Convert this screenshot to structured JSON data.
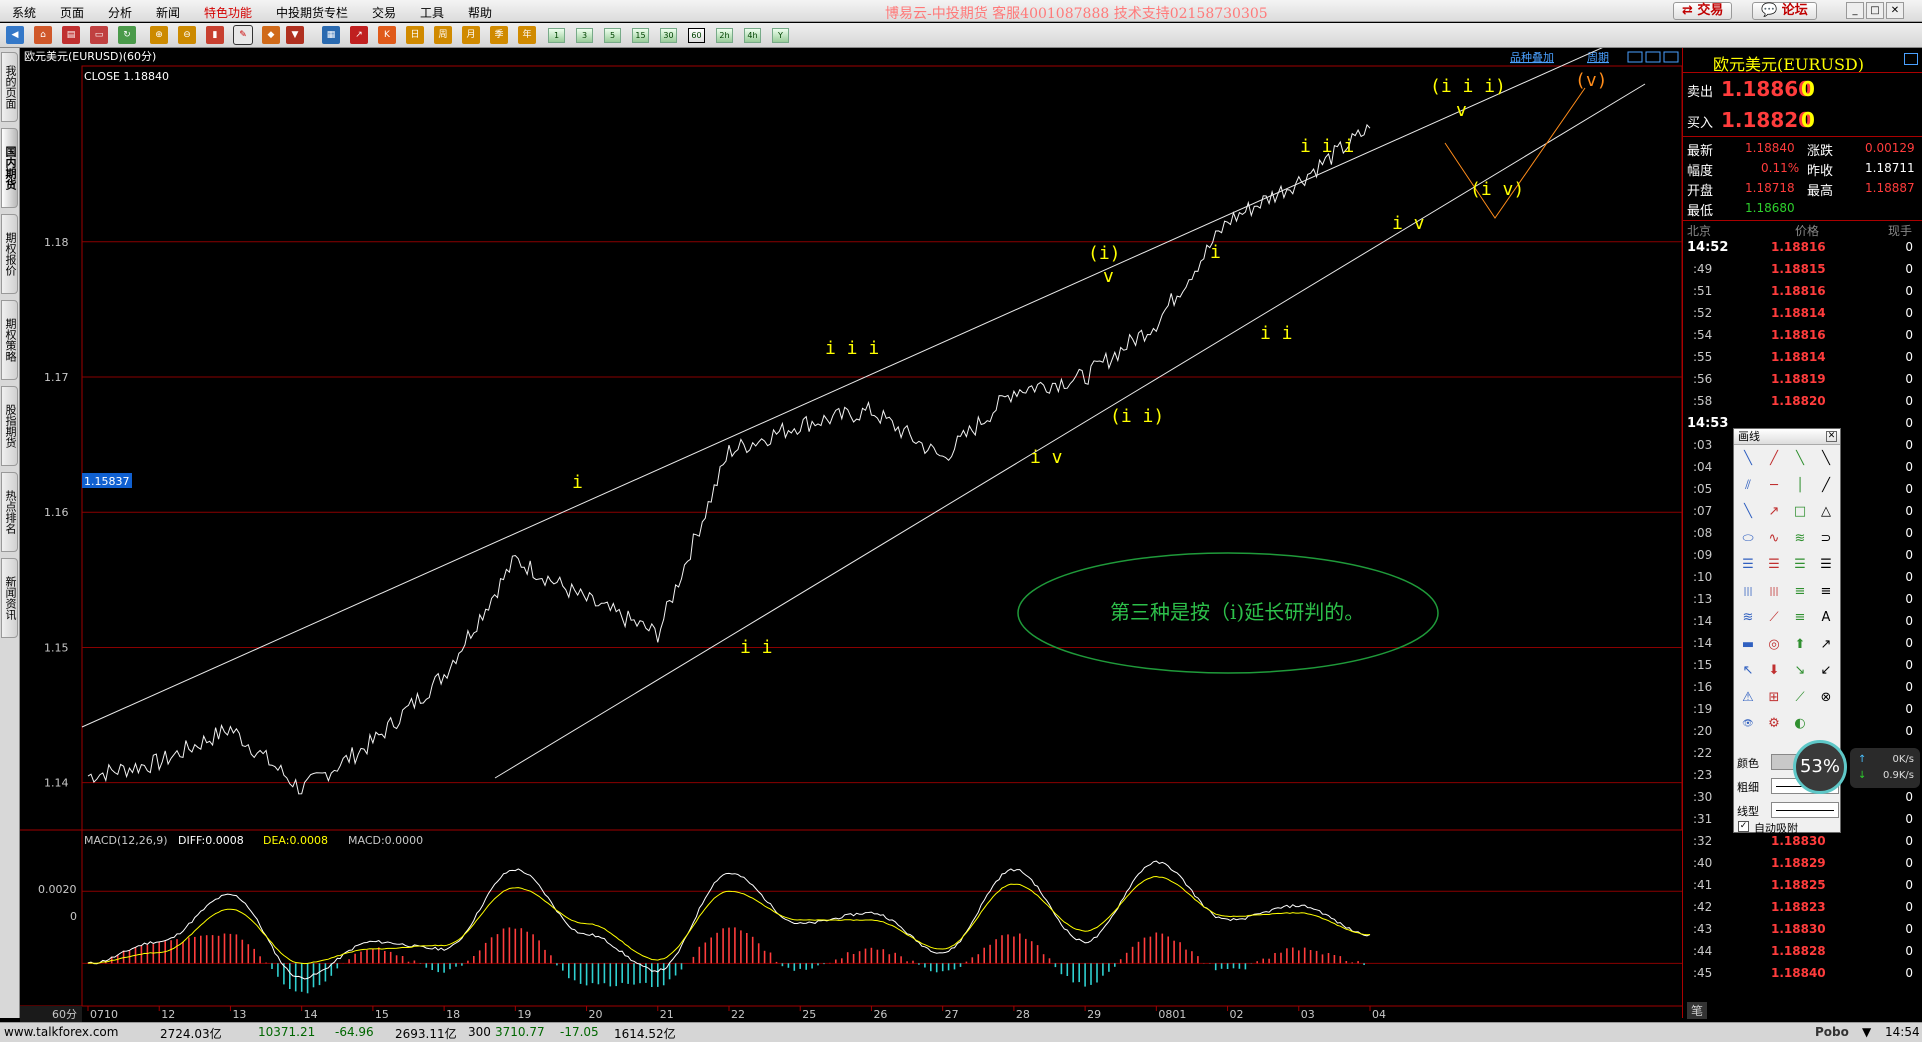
{
  "menu": {
    "items": [
      "系统",
      "页面",
      "分析",
      "新闻",
      "特色功能",
      "中投期货专栏",
      "交易",
      "工具",
      "帮助"
    ],
    "brand_text": "博易云-中投期货 客服4001087888 技术支持02158730305",
    "trade_button": "交易",
    "forum_button": "论坛"
  },
  "toolbar": {
    "period_buttons": [
      "1",
      "3",
      "5",
      "15",
      "30",
      "60",
      "2h",
      "4h",
      "Y"
    ]
  },
  "left_tabs": [
    "我的页面",
    "国内期货",
    "期权报价",
    "期权策略",
    "股指期货",
    "热点排名",
    "新闻资讯"
  ],
  "chart": {
    "title": "欧元美元(EURUSD)(60分)",
    "close_label": "CLOSE 1.18840",
    "overlay_btn": "品种叠加",
    "period_link": "周期",
    "cursor_price": "1.15837",
    "price_ticks": [
      "1.18",
      "1.17",
      "1.16",
      "1.15",
      "1.14"
    ],
    "macd_label": "MACD(12,26,9)",
    "diff_label": "DIFF:0.0008",
    "dea_label": "DEA:0.0008",
    "macd_value": "MACD:0.0000",
    "macd_ticks": [
      "0.0020",
      "0"
    ],
    "period_tag": "60分",
    "date_ticks": [
      "0710",
      "12",
      "13",
      "14",
      "15",
      "18",
      "19",
      "20",
      "21",
      "22",
      "25",
      "26",
      "27",
      "28",
      "29",
      "0801",
      "02",
      "03",
      "04"
    ],
    "wave_labels": [
      {
        "text": "i",
        "color": "yellow"
      },
      {
        "text": "i i",
        "color": "yellow"
      },
      {
        "text": "i i i",
        "color": "yellow"
      },
      {
        "text": "i v",
        "color": "yellow"
      },
      {
        "text": "(i)",
        "color": "yellow"
      },
      {
        "text": "v",
        "color": "yellow"
      },
      {
        "text": "(i i)",
        "color": "yellow"
      },
      {
        "text": "i",
        "color": "yellow"
      },
      {
        "text": "i i",
        "color": "yellow"
      },
      {
        "text": "i i i",
        "color": "yellow"
      },
      {
        "text": "i v",
        "color": "yellow"
      },
      {
        "text": "(i i i)",
        "color": "yellow"
      },
      {
        "text": "v",
        "color": "yellow"
      },
      {
        "text": "(i v)",
        "color": "yellow"
      },
      {
        "text": "(v)",
        "color": "orange"
      }
    ],
    "annotation": "第三种是按（i)延长研判的。",
    "colors": {
      "line": "#ffffff",
      "wave": "#ffff00",
      "orange": "#ff8c1a",
      "macd_up": "#ff3c3c",
      "macd_down": "#2fd0d0",
      "dea": "#ffff00",
      "grid": "#8a0000",
      "ellipse": "#1f9a3a"
    }
  },
  "chart_data": {
    "type": "line",
    "title": "欧元美元(EURUSD)(60分)",
    "ylabel": "",
    "xlabel": "",
    "ylim": [
      1.1365,
      1.193
    ],
    "x": [
      "0710",
      "12",
      "13",
      "14",
      "15",
      "18",
      "19",
      "20",
      "21",
      "22",
      "25",
      "26",
      "27",
      "28",
      "29",
      "0801",
      "02",
      "03",
      "04"
    ],
    "series": [
      {
        "name": "CLOSE",
        "values": [
          1.1405,
          1.1415,
          1.144,
          1.1395,
          1.143,
          1.148,
          1.1565,
          1.1535,
          1.151,
          1.1645,
          1.1665,
          1.1675,
          1.164,
          1.169,
          1.17,
          1.174,
          1.1815,
          1.1845,
          1.1884
        ]
      }
    ],
    "macd": {
      "label": "MACD(12,26,9)",
      "ylim": [
        -0.0011,
        0.0032
      ],
      "diff": [
        0.0,
        0.0006,
        0.0019,
        -0.0004,
        0.0006,
        0.0004,
        0.0026,
        0.0008,
        -0.0002,
        0.0025,
        0.0011,
        0.0014,
        0.0003,
        0.0026,
        0.0006,
        0.0028,
        0.0012,
        0.0016,
        0.0008
      ],
      "dea": [
        0.0,
        0.0003,
        0.0015,
        0.0,
        0.0004,
        0.0005,
        0.0021,
        0.0011,
        0.0001,
        0.002,
        0.0012,
        0.0012,
        0.0004,
        0.0022,
        0.0009,
        0.0024,
        0.0013,
        0.0014,
        0.0008
      ]
    }
  },
  "quote": {
    "title": "欧元美元(EURUSD)",
    "sell_label": "卖出",
    "sell_price": "1.18860",
    "sell_qty": "0",
    "buy_label": "买入",
    "buy_price": "1.18820",
    "buy_qty": "0",
    "stats": [
      {
        "k1": "最新",
        "v1": "1.18840",
        "k2": "涨跌",
        "v2": "0.00129"
      },
      {
        "k1": "幅度",
        "v1": "0.11%",
        "k2": "昨收",
        "v2": "1.18711"
      },
      {
        "k1": "开盘",
        "v1": "1.18718",
        "k2": "最高",
        "v2": "1.18887"
      },
      {
        "k1": "最低",
        "v1": "1.18680",
        "k2": "",
        "v2": ""
      }
    ],
    "ticks_header": {
      "time": "北京",
      "price": "价格",
      "vol": "现手"
    },
    "ticks": [
      {
        "t": "14:52",
        "p": "1.18816",
        "v": "0",
        "full": true
      },
      {
        "t": ":49",
        "p": "1.18815",
        "v": "0"
      },
      {
        "t": ":51",
        "p": "1.18816",
        "v": "0"
      },
      {
        "t": ":52",
        "p": "1.18814",
        "v": "0"
      },
      {
        "t": ":54",
        "p": "1.18816",
        "v": "0"
      },
      {
        "t": ":55",
        "p": "1.18814",
        "v": "0"
      },
      {
        "t": ":56",
        "p": "1.18819",
        "v": "0"
      },
      {
        "t": ":58",
        "p": "1.18820",
        "v": "0"
      },
      {
        "t": "14:53",
        "p": "",
        "v": "0",
        "full": true
      },
      {
        "t": ":03",
        "p": "",
        "v": "0"
      },
      {
        "t": ":04",
        "p": "",
        "v": "0"
      },
      {
        "t": ":05",
        "p": "",
        "v": "0"
      },
      {
        "t": ":07",
        "p": "",
        "v": "0"
      },
      {
        "t": ":08",
        "p": "",
        "v": "0"
      },
      {
        "t": ":09",
        "p": "",
        "v": "0"
      },
      {
        "t": ":10",
        "p": "",
        "v": "0"
      },
      {
        "t": ":13",
        "p": "",
        "v": "0"
      },
      {
        "t": ":14",
        "p": "",
        "v": "0"
      },
      {
        "t": ":14",
        "p": "",
        "v": "0"
      },
      {
        "t": ":15",
        "p": "",
        "v": "0"
      },
      {
        "t": ":16",
        "p": "",
        "v": "0"
      },
      {
        "t": ":19",
        "p": "",
        "v": "0"
      },
      {
        "t": ":20",
        "p": "",
        "v": "0"
      },
      {
        "t": ":22",
        "p": "",
        "v": "0"
      },
      {
        "t": ":23",
        "p": "",
        "v": "0"
      },
      {
        "t": ":30",
        "p": "",
        "v": "0"
      },
      {
        "t": ":31",
        "p": "",
        "v": "0"
      },
      {
        "t": ":32",
        "p": "1.18830",
        "v": "0"
      },
      {
        "t": ":40",
        "p": "1.18829",
        "v": "0"
      },
      {
        "t": ":41",
        "p": "1.18825",
        "v": "0"
      },
      {
        "t": ":42",
        "p": "1.18823",
        "v": "0"
      },
      {
        "t": ":43",
        "p": "1.18830",
        "v": "0"
      },
      {
        "t": ":44",
        "p": "1.18828",
        "v": "0"
      },
      {
        "t": ":45",
        "p": "1.18840",
        "v": "0"
      }
    ],
    "footer_tab": "笔"
  },
  "draw_panel": {
    "title": "画线",
    "color_label": "颜色",
    "width_label": "粗细",
    "style_label": "线型",
    "auto_snap_label": "自动吸附"
  },
  "net": {
    "percent": "53%",
    "up": "0K/s",
    "down": "0.9K/s"
  },
  "status": {
    "site": "www.talkforex.com",
    "idx1_name": "",
    "idx1_amount": "2724.03亿",
    "idx2_value": "10371.21",
    "idx2_change": "-64.96",
    "idx2_amount": "2693.11亿",
    "idx3_name": "300",
    "idx3_value": "3710.77",
    "idx3_change": "-17.05",
    "idx3_amount": "1614.52亿",
    "app": "Pobo",
    "time": "14:54"
  }
}
